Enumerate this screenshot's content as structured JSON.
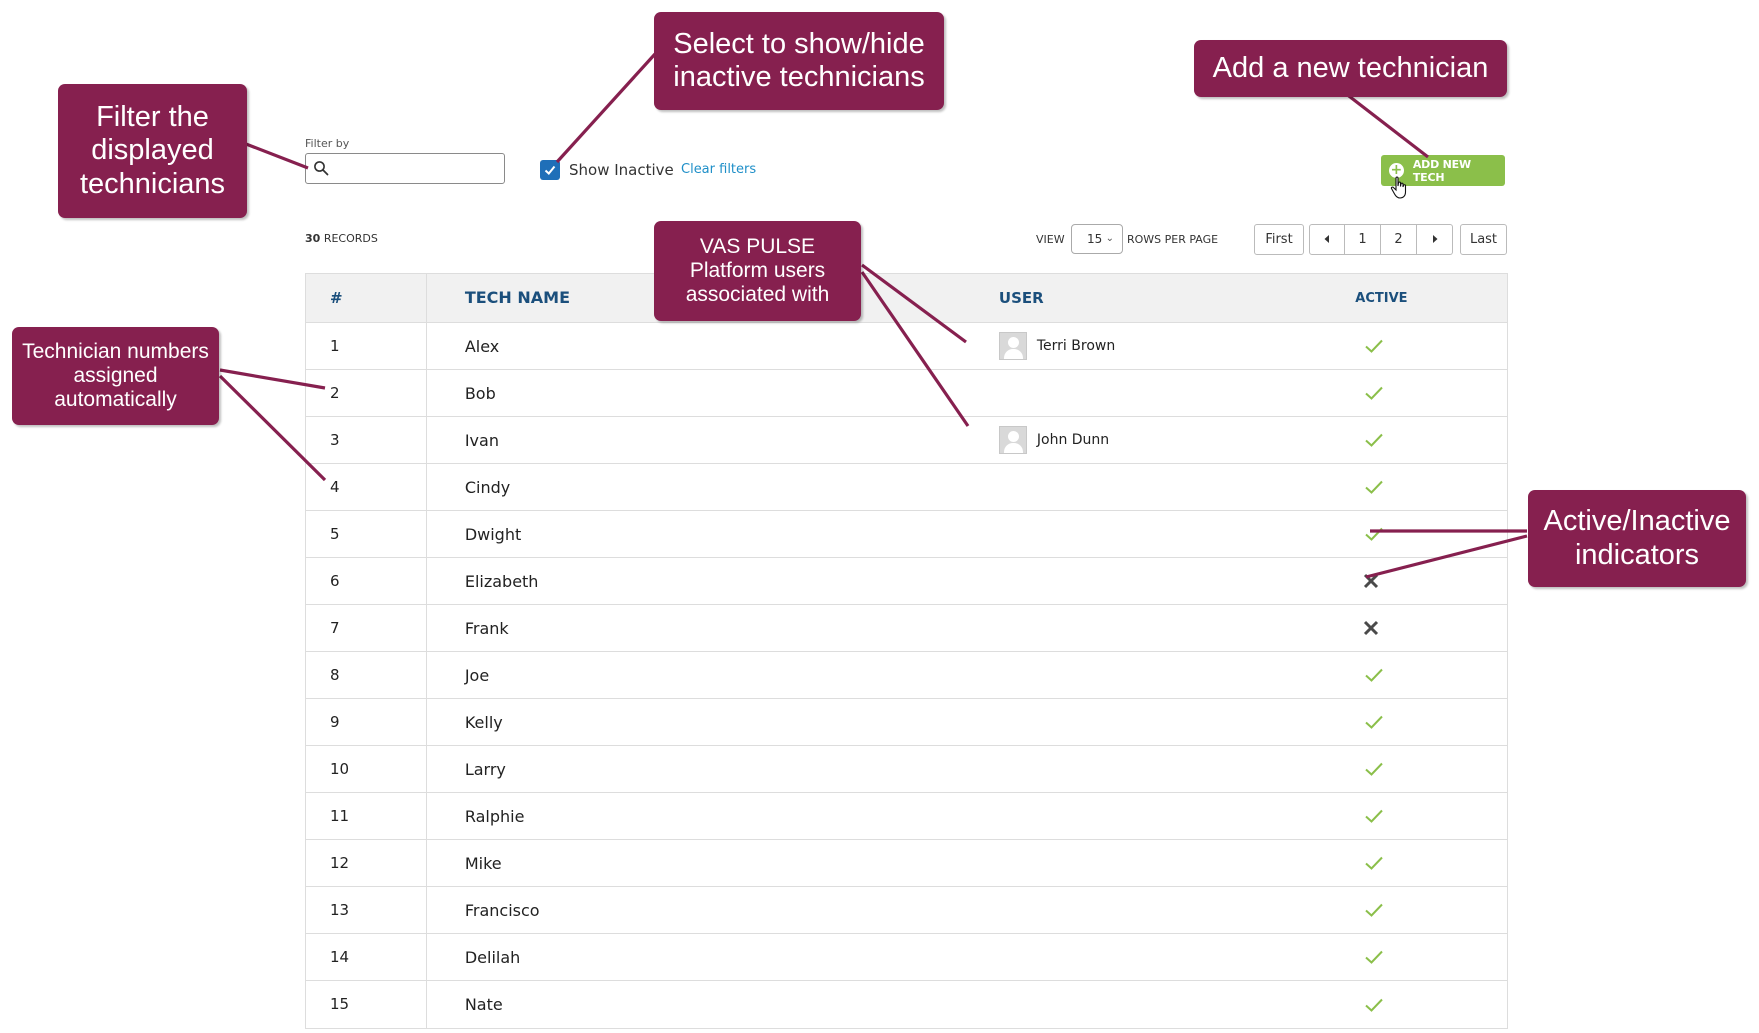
{
  "filter": {
    "label": "Filter by",
    "value": "",
    "placeholder": ""
  },
  "show_inactive": {
    "label": "Show Inactive",
    "checked": true
  },
  "clear_filters": "Clear filters",
  "add_button": "ADD NEW TECH",
  "records": {
    "count": "30",
    "label": "RECORDS"
  },
  "pagination": {
    "view_label": "VIEW",
    "rows_per_page": "15",
    "rows_label": "ROWS PER PAGE",
    "first": "First",
    "pages": [
      "1",
      "2"
    ],
    "last": "Last"
  },
  "table": {
    "headers": {
      "num": "#",
      "name": "TECH NAME",
      "user": "USER",
      "active": "ACTIVE"
    },
    "rows": [
      {
        "num": "1",
        "name": "Alex",
        "user": "Terri Brown",
        "active": true
      },
      {
        "num": "2",
        "name": "Bob",
        "user": "",
        "active": true
      },
      {
        "num": "3",
        "name": "Ivan",
        "user": "John Dunn",
        "active": true
      },
      {
        "num": "4",
        "name": "Cindy",
        "user": "",
        "active": true
      },
      {
        "num": "5",
        "name": "Dwight",
        "user": "",
        "active": true
      },
      {
        "num": "6",
        "name": "Elizabeth",
        "user": "",
        "active": false
      },
      {
        "num": "7",
        "name": "Frank",
        "user": "",
        "active": false
      },
      {
        "num": "8",
        "name": "Joe",
        "user": "",
        "active": true
      },
      {
        "num": "9",
        "name": "Kelly",
        "user": "",
        "active": true
      },
      {
        "num": "10",
        "name": "Larry",
        "user": "",
        "active": true
      },
      {
        "num": "11",
        "name": "Ralphie",
        "user": "",
        "active": true
      },
      {
        "num": "12",
        "name": "Mike",
        "user": "",
        "active": true
      },
      {
        "num": "13",
        "name": "Francisco",
        "user": "",
        "active": true
      },
      {
        "num": "14",
        "name": "Delilah",
        "user": "",
        "active": true
      },
      {
        "num": "15",
        "name": "Nate",
        "user": "",
        "active": true
      }
    ]
  },
  "callouts": {
    "filter": [
      "Filter the",
      "displayed",
      "technicians"
    ],
    "show_inactive": [
      "Select to show/hide",
      "inactive technicians"
    ],
    "add_tech": [
      "Add a new technician"
    ],
    "users": [
      "VAS PULSE",
      "Platform users",
      "associated with"
    ],
    "numbers": [
      "Technician numbers",
      "assigned",
      "automatically"
    ],
    "active": [
      "Active/Inactive",
      "indicators"
    ]
  },
  "colors": {
    "callout": "#86204f",
    "accent_green": "#8bbf4a",
    "checkbox_blue": "#1f6fb8",
    "link_blue": "#1f8fc8",
    "header_text": "#1b4f7c",
    "check_green": "#8bbf4a",
    "cross_gray": "#4a4a4a"
  }
}
